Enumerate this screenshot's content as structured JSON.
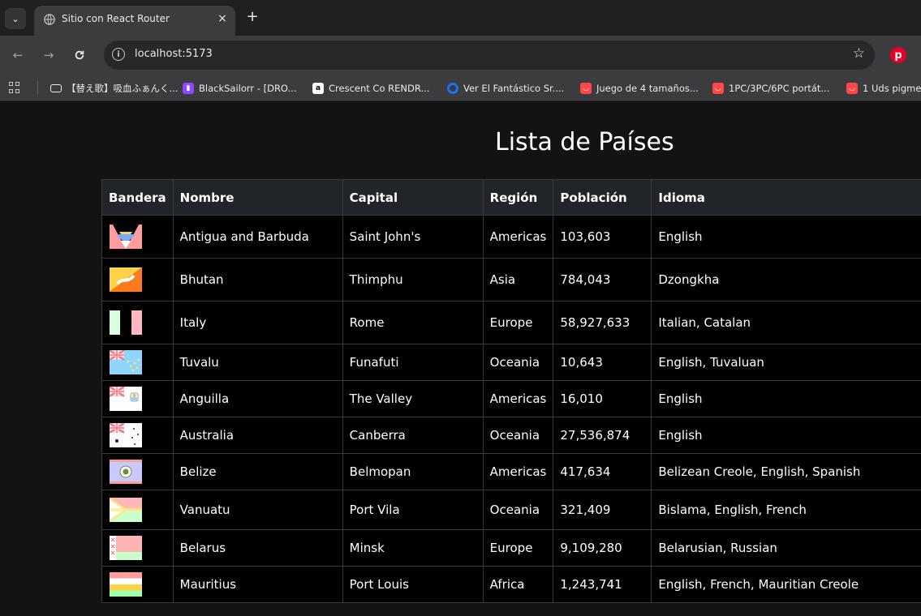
{
  "browser": {
    "tab_title": "Sitio con React Router",
    "tab_close": "×",
    "new_tab": "+",
    "url": "localhost:5173",
    "bookmarks": [
      {
        "label": "【替え歌】吸血ふぁんく...",
        "icon": "video-icon",
        "color": "#e8eaed"
      },
      {
        "label": "BlackSailorr - [DRO...",
        "icon": "twitch-icon",
        "color": "#9146ff"
      },
      {
        "label": "Crescent Co RENDR...",
        "icon": "amazon-icon",
        "color": "#ffffff"
      },
      {
        "label": "Ver El Fantástico Sr....",
        "icon": "streaming-icon",
        "color": "#1a73e8"
      },
      {
        "label": "Juego de 4 tamaños...",
        "icon": "aliexpress-icon",
        "color": "#ff4747"
      },
      {
        "label": "1PC/3PC/6PC portát...",
        "icon": "aliexpress-icon",
        "color": "#ff4747"
      },
      {
        "label": "1 Uds pigme",
        "icon": "aliexpress-icon",
        "color": "#ff4747"
      }
    ]
  },
  "page": {
    "heading": "Lista de Países",
    "columns": [
      "Bandera",
      "Nombre",
      "Capital",
      "Región",
      "Población",
      "Idioma"
    ],
    "rows": [
      {
        "flag": "antigua-and-barbuda-flag",
        "name": "Antigua and Barbuda",
        "capital": "Saint John's",
        "region": "Americas",
        "population": "103,603",
        "language": "English"
      },
      {
        "flag": "bhutan-flag",
        "name": "Bhutan",
        "capital": "Thimphu",
        "region": "Asia",
        "population": "784,043",
        "language": "Dzongkha"
      },
      {
        "flag": "italy-flag",
        "name": "Italy",
        "capital": "Rome",
        "region": "Europe",
        "population": "58,927,633",
        "language": "Italian, Catalan"
      },
      {
        "flag": "tuvalu-flag",
        "name": "Tuvalu",
        "capital": "Funafuti",
        "region": "Oceania",
        "population": "10,643",
        "language": "English, Tuvaluan"
      },
      {
        "flag": "anguilla-flag",
        "name": "Anguilla",
        "capital": "The Valley",
        "region": "Americas",
        "population": "16,010",
        "language": "English"
      },
      {
        "flag": "australia-flag",
        "name": "Australia",
        "capital": "Canberra",
        "region": "Oceania",
        "population": "27,536,874",
        "language": "English"
      },
      {
        "flag": "belize-flag",
        "name": "Belize",
        "capital": "Belmopan",
        "region": "Americas",
        "population": "417,634",
        "language": "Belizean Creole, English, Spanish"
      },
      {
        "flag": "vanuatu-flag",
        "name": "Vanuatu",
        "capital": "Port Vila",
        "region": "Oceania",
        "population": "321,409",
        "language": "Bislama, English, French"
      },
      {
        "flag": "belarus-flag",
        "name": "Belarus",
        "capital": "Minsk",
        "region": "Europe",
        "population": "9,109,280",
        "language": "Belarusian, Russian"
      },
      {
        "flag": "mauritius-flag",
        "name": "Mauritius",
        "capital": "Port Louis",
        "region": "Africa",
        "population": "1,243,741",
        "language": "English, French, Mauritian Creole"
      }
    ]
  }
}
